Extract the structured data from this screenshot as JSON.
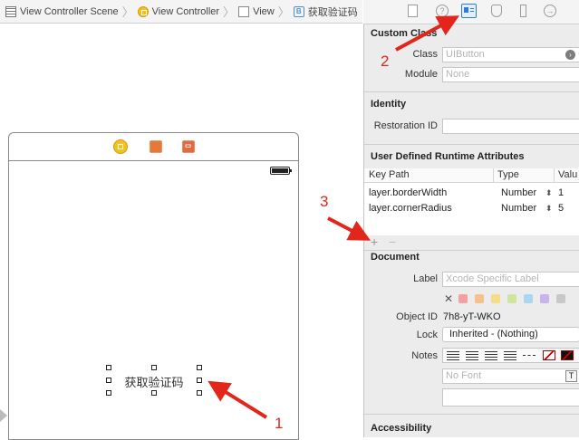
{
  "breadcrumb": [
    {
      "label": "View Controller Scene",
      "icon": "scene-icon"
    },
    {
      "label": "View Controller",
      "icon": "view-controller-icon"
    },
    {
      "label": "View",
      "icon": "view-icon"
    },
    {
      "label": "获取验证码",
      "icon": "button-icon",
      "icon_glyph": "B"
    }
  ],
  "inspector_tabs": [
    {
      "name": "file-inspector-icon"
    },
    {
      "name": "quick-help-icon",
      "glyph": "?"
    },
    {
      "name": "identity-inspector-icon",
      "selected": true
    },
    {
      "name": "attributes-inspector-icon"
    },
    {
      "name": "size-inspector-icon"
    },
    {
      "name": "connections-inspector-icon",
      "glyph": "→"
    }
  ],
  "custom_class": {
    "header": "Custom Class",
    "class_label": "Class",
    "class_placeholder": "UIButton",
    "module_label": "Module",
    "module_placeholder": "None"
  },
  "identity": {
    "header": "Identity",
    "restoration_label": "Restoration ID",
    "restoration_value": ""
  },
  "udra": {
    "header": "User Defined Runtime Attributes",
    "columns": [
      "Key Path",
      "Type",
      "Valu"
    ],
    "rows": [
      {
        "key_path": "layer.borderWidth",
        "type": "Number",
        "value": "1"
      },
      {
        "key_path": "layer.cornerRadius",
        "type": "Number",
        "value": "5"
      }
    ],
    "add_symbol": "+",
    "remove_symbol": "−"
  },
  "document": {
    "header": "Document",
    "label_label": "Label",
    "label_placeholder": "Xcode Specific Label",
    "color_swatches": [
      "#f4a0a0",
      "#f8c08a",
      "#f6dc86",
      "#cfe59c",
      "#aad7ef",
      "#c9b3ec",
      "#c8c8c8"
    ],
    "clear_symbol": "✕",
    "object_id_label": "Object ID",
    "object_id_value": "7h8-yT-WKO",
    "lock_label": "Lock",
    "lock_value": "Inherited - (Nothing)",
    "notes_label": "Notes",
    "font_placeholder": "No Font",
    "font_button": "T"
  },
  "accessibility": {
    "header": "Accessibility"
  },
  "canvas": {
    "selected_button_label": "获取验证码"
  },
  "annotations": {
    "arrow_color": "#e2261c",
    "step1": "1",
    "step2": "2",
    "step3": "3"
  }
}
